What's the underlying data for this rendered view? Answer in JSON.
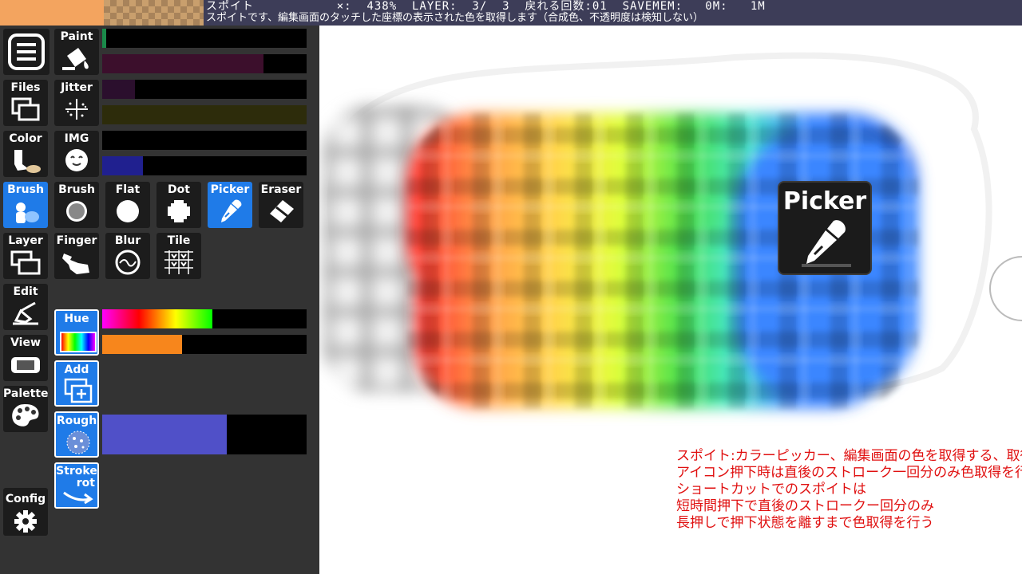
{
  "status_bar": {
    "line1": "スポイト           ×:  438%  LAYER:  3/  3  戻れる回数:01  SAVEMEM:   0M:   1M",
    "line2": "スポイトです、編集画面のタッチした座標の表示された色を取得します（合成色、不透明度は検知しない）",
    "current_color": "#f3a45f"
  },
  "menu_buttons": {
    "menu": "",
    "files": "Files",
    "color": "Color",
    "brush": "Brush",
    "layer": "Layer",
    "edit": "Edit",
    "view": "View",
    "palette": "Palette",
    "config": "Config"
  },
  "tool_buttons": {
    "paint": "Paint",
    "jitter": "Jitter",
    "img": "IMG",
    "brush": "Brush",
    "flat": "Flat",
    "dot": "Dot",
    "picker": "Picker",
    "eraser": "Eraser",
    "finger": "Finger",
    "blur": "Blur",
    "tile": "Tile",
    "hue": "Hue",
    "add": "Add",
    "rough": "Rough",
    "stroke_rot_1": "Stroke",
    "stroke_rot_2": "rot"
  },
  "sliders": [
    {
      "color": "#1a8a4a",
      "value": 0.02
    },
    {
      "color": "#3c0f2c",
      "value": 0.79
    },
    {
      "color": "#2b0f2d",
      "value": 0.16
    },
    {
      "color": "#2d2c0b",
      "value": 1.0
    },
    {
      "color": "#000000",
      "value": 0.0
    },
    {
      "color": "#20208f",
      "value": 0.2
    },
    {
      "color": "hue-gradient",
      "value": 0.54
    },
    {
      "color": "#f7861c",
      "value": 0.39
    },
    {
      "color": "#5050c8",
      "value": 0.61
    }
  ],
  "canvas": {
    "picker_label": "Picker",
    "info_lines": [
      "スポイト:カラーピッカー、編集画面の色を取得する、取得色情報は合成表示色",
      "アイコン押下時は直後のストローク一回分のみ色取得を行い直前のペンモードに戻る",
      "ショートカットでのスポイトは",
      "短時間押下で直後のストロークー回分のみ",
      "長押しで押下状態を離すまで色取得を行う"
    ],
    "info_color": "#e01010"
  }
}
